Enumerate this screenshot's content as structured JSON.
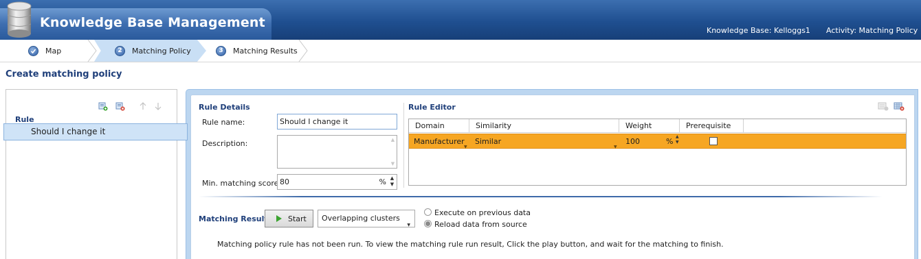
{
  "header": {
    "title": "Knowledge Base Management",
    "knowledge_base": "Knowledge Base: Kelloggs1",
    "activity": "Activity: Matching Policy",
    "icon": "database-icon"
  },
  "steps": [
    {
      "number": "",
      "label": "Map",
      "state": "complete",
      "icon": "check-icon"
    },
    {
      "number": "2",
      "label": "Matching Policy",
      "state": "active"
    },
    {
      "number": "3",
      "label": "Matching Results",
      "state": "pending"
    }
  ],
  "page_title": "Create matching policy",
  "rules_panel": {
    "header": "Rule",
    "items": [
      "Should I change it"
    ],
    "toolbar_icons": [
      "add-rule-icon",
      "delete-rule-icon",
      "move-up-icon",
      "move-down-icon"
    ]
  },
  "rule_details": {
    "title": "Rule Details",
    "name_label": "Rule name:",
    "name_value": "Should I change it",
    "description_label": "Description:",
    "description_value": "",
    "min_score_label": "Min. matching score:",
    "min_score_value": "80",
    "min_score_unit": "%"
  },
  "rule_editor": {
    "title": "Rule Editor",
    "columns": [
      "Domain",
      "Similarity",
      "Weight",
      "Prerequisite"
    ],
    "rows": [
      {
        "domain": "Manufacturer",
        "similarity": "Similar",
        "weight": "100",
        "weight_unit": "%",
        "prerequisite": false
      }
    ],
    "toolbar_icons": [
      "add-domain-element-icon",
      "delete-domain-element-icon"
    ]
  },
  "matching_results": {
    "title": "Matching Results",
    "start_label": "Start",
    "mode_value": "Overlapping clusters",
    "options": [
      {
        "label": "Execute on previous data",
        "selected": false
      },
      {
        "label": "Reload data from source",
        "selected": true
      }
    ],
    "note": "Matching policy rule has not been run. To view the matching rule run result, Click the play button, and wait for the matching to finish."
  },
  "colors": {
    "header_blue": "#1f4f90",
    "title_blue": "#1f3f7a",
    "selected_row": "#f6a623",
    "selection_blue": "#cfe3f7"
  }
}
